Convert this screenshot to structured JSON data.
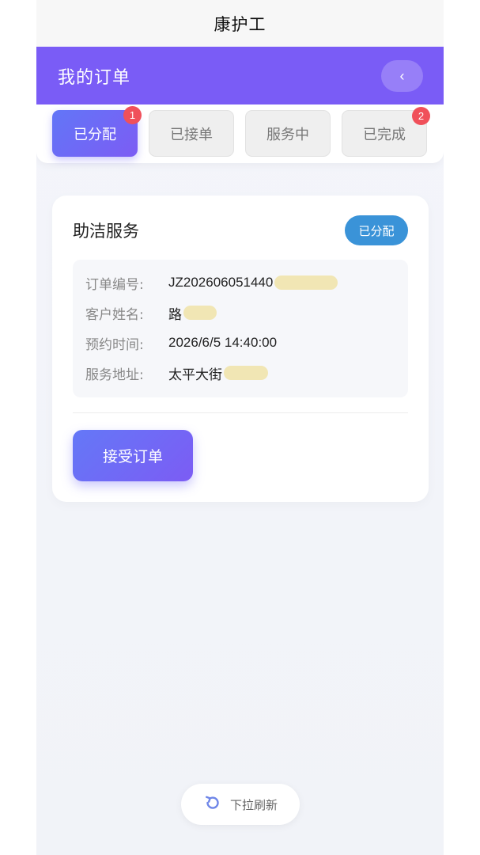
{
  "appbar": {
    "title": "康护工"
  },
  "header": {
    "title": "我的订单",
    "back_label": "‹"
  },
  "tabs": [
    {
      "label": "已分配",
      "badge": "1",
      "active": true
    },
    {
      "label": "已接单",
      "badge": "",
      "active": false
    },
    {
      "label": "服务中",
      "badge": "",
      "active": false
    },
    {
      "label": "已完成",
      "badge": "2",
      "active": false
    }
  ],
  "order": {
    "title": "助洁服务",
    "status": "已分配",
    "fields": [
      {
        "label": "订单编号:",
        "value": "JZ202606051440"
      },
      {
        "label": "客户姓名:",
        "value": "路"
      },
      {
        "label": "预约时间:",
        "value": "2026/6/5 14:40:00"
      },
      {
        "label": "服务地址:",
        "value": "太平大街"
      }
    ],
    "accept_label": "接受订单"
  },
  "refresh": {
    "label": "下拉刷新",
    "icon": "refresh-icon"
  },
  "colors": {
    "header": "#7a5cf6",
    "accent_gradient_start": "#6276f7",
    "accent_gradient_end": "#7c5cf4",
    "status_pill": "#3a93d8",
    "badge": "#f0505a"
  }
}
